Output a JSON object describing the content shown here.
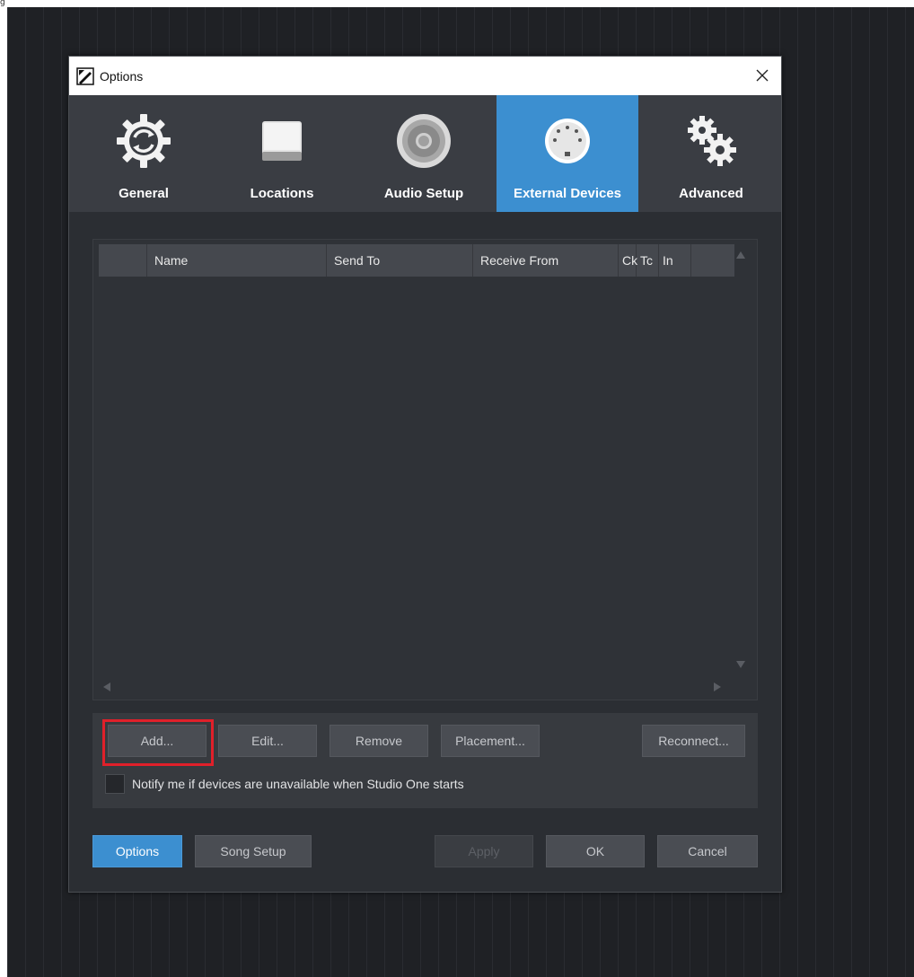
{
  "dialog": {
    "title": "Options",
    "close_glyph": "✕"
  },
  "tabs": [
    {
      "label": "General",
      "icon": "gear-refresh-icon",
      "active": false
    },
    {
      "label": "Locations",
      "icon": "drive-icon",
      "active": false
    },
    {
      "label": "Audio Setup",
      "icon": "speaker-icon",
      "active": false
    },
    {
      "label": "External Devices",
      "icon": "midi-connector-icon",
      "active": true
    },
    {
      "label": "Advanced",
      "icon": "gears-icon",
      "active": false
    }
  ],
  "device_table": {
    "columns": [
      "",
      "Name",
      "Send To",
      "Receive From",
      "Ck",
      "Tc",
      "In"
    ],
    "rows": []
  },
  "buttons": {
    "add": "Add...",
    "edit": "Edit...",
    "remove": "Remove",
    "placement": "Placement...",
    "reconnect": "Reconnect..."
  },
  "notify": {
    "label": "Notify me if devices are unavailable when Studio One starts",
    "checked": false
  },
  "footer": {
    "options": "Options",
    "song_setup": "Song Setup",
    "apply": "Apply",
    "ok": "OK",
    "cancel": "Cancel"
  },
  "colors": {
    "accent": "#3c8fd0",
    "highlight": "#e0202a"
  }
}
